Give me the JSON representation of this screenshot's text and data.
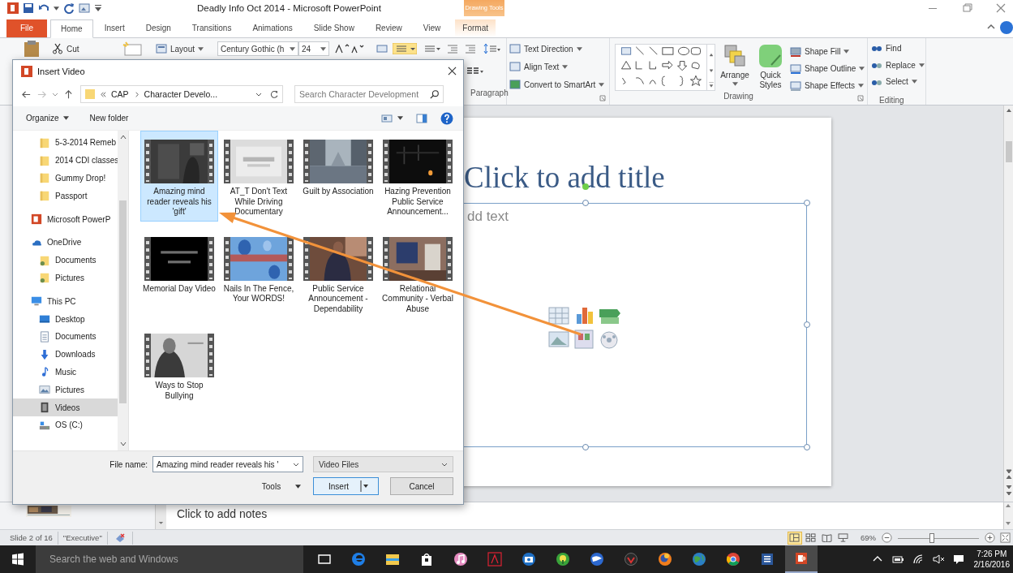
{
  "window": {
    "title": "Deadly Info Oct 2014  -  Microsoft PowerPoint",
    "context_label": "Drawing Tools"
  },
  "tabs": [
    {
      "label": "File",
      "kind": "file",
      "selected": false
    },
    {
      "label": "Home",
      "kind": "main",
      "selected": true
    },
    {
      "label": "Insert",
      "kind": "main",
      "selected": false
    },
    {
      "label": "Design",
      "kind": "main",
      "selected": false
    },
    {
      "label": "Transitions",
      "kind": "main",
      "selected": false
    },
    {
      "label": "Animations",
      "kind": "main",
      "selected": false
    },
    {
      "label": "Slide Show",
      "kind": "main",
      "selected": false
    },
    {
      "label": "Review",
      "kind": "main",
      "selected": false
    },
    {
      "label": "View",
      "kind": "main",
      "selected": false
    },
    {
      "label": "Format",
      "kind": "contextual",
      "selected": false
    }
  ],
  "ribbon": {
    "cut": "Cut",
    "layout": {
      "label": "Layout",
      "dropdown": true
    },
    "font": {
      "name": "Century Gothic (h",
      "size": "24"
    },
    "paragraph_label": "Paragraph",
    "text_commands": [
      {
        "label": "Text Direction",
        "dropdown": true
      },
      {
        "label": "Align Text",
        "dropdown": true
      },
      {
        "label": "Convert to SmartArt",
        "dropdown": true
      }
    ],
    "arrange": "Arrange",
    "quick_styles": "Quick Styles",
    "shape_commands": [
      {
        "label": "Shape Fill",
        "dropdown": true
      },
      {
        "label": "Shape Outline",
        "dropdown": true
      },
      {
        "label": "Shape Effects",
        "dropdown": true
      }
    ],
    "drawing_label": "Drawing",
    "editing_commands": [
      {
        "label": "Find",
        "dropdown": false
      },
      {
        "label": "Replace",
        "dropdown": true
      },
      {
        "label": "Select",
        "dropdown": true
      }
    ],
    "editing_label": "Editing"
  },
  "slide": {
    "title_placeholder": "Click to add title",
    "body_text": "dd text"
  },
  "notes": {
    "placeholder": "Click to add notes"
  },
  "status_bar": {
    "slide": "Slide 2 of 16",
    "theme": "\"Executive\"",
    "views": [
      {
        "kind": "normal",
        "selected": true
      },
      {
        "kind": "sorter",
        "selected": false
      },
      {
        "kind": "reading",
        "selected": false
      },
      {
        "kind": "show",
        "selected": false
      }
    ],
    "zoom": "69%",
    "zoom_slider": {
      "level": 0.42
    }
  },
  "taskbar": {
    "search": {
      "placeholder": "Search the web and Windows"
    },
    "apps": [
      {
        "kind": "taskview",
        "active": false
      },
      {
        "kind": "edge",
        "active": false
      },
      {
        "kind": "explorer",
        "active": false
      },
      {
        "kind": "store",
        "active": false
      },
      {
        "kind": "itunes",
        "active": false
      },
      {
        "kind": "acrobat",
        "active": false
      },
      {
        "kind": "camera",
        "active": false
      },
      {
        "kind": "green",
        "active": false
      },
      {
        "kind": "earth",
        "active": false
      },
      {
        "kind": "vivaldi",
        "active": false
      },
      {
        "kind": "firefox",
        "active": false
      },
      {
        "kind": "globe",
        "active": false
      },
      {
        "kind": "chrome",
        "active": false
      },
      {
        "kind": "word",
        "active": false
      },
      {
        "kind": "powerpoint",
        "active": true
      }
    ],
    "time": "7:26 PM",
    "date": "2/16/2016"
  },
  "dialog": {
    "title": "Insert Video",
    "address": [
      "CAP",
      "Character Develo..."
    ],
    "search": {
      "placeholder": "Search Character Development"
    },
    "toolbar": [
      {
        "label": "Organize",
        "dropdown": true
      },
      {
        "label": "New folder",
        "dropdown": false
      }
    ],
    "nav_pane": {
      "scrolled_children": [
        {
          "label": "5-3-2014 Remeb",
          "kind": "folder",
          "selected": false
        },
        {
          "label": "2014 CDI classes",
          "kind": "folder",
          "selected": false
        },
        {
          "label": "Gummy Drop!",
          "kind": "folder",
          "selected": false
        },
        {
          "label": "Passport",
          "kind": "folder",
          "selected": false
        }
      ],
      "items": [
        {
          "label": "Microsoft PowerP",
          "kind": "powerpoint",
          "selected": false
        },
        {
          "label": "OneDrive",
          "kind": "onedrive",
          "selected": false,
          "children": [
            {
              "label": "Documents",
              "kind": "onedrive-folder",
              "selected": false
            },
            {
              "label": "Pictures",
              "kind": "onedrive-folder",
              "selected": false
            }
          ]
        },
        {
          "label": "This PC",
          "kind": "pc",
          "selected": false,
          "children": [
            {
              "label": "Desktop",
              "kind": "desktop",
              "selected": false
            },
            {
              "label": "Documents",
              "kind": "documents",
              "selected": false
            },
            {
              "label": "Downloads",
              "kind": "downloads",
              "selected": false
            },
            {
              "label": "Music",
              "kind": "music",
              "selected": false
            },
            {
              "label": "Pictures",
              "kind": "pictures",
              "selected": false
            },
            {
              "label": "Videos",
              "kind": "videos",
              "selected": true
            },
            {
              "label": "OS (C:)",
              "kind": "drive",
              "selected": false
            }
          ]
        }
      ]
    },
    "files": [
      {
        "name": "Amazing mind reader reveals his 'gift'",
        "selected": true
      },
      {
        "name": "AT_T Don't Text While Driving Documentary",
        "selected": false
      },
      {
        "name": "Guilt by Association",
        "selected": false
      },
      {
        "name": "Hazing Prevention Public Service Announcement...",
        "selected": false
      },
      {
        "name": "Memorial Day Video",
        "selected": false
      },
      {
        "name": "Nails In The Fence, Your WORDS!",
        "selected": false
      },
      {
        "name": "Public Service Announcement - Dependability",
        "selected": false
      },
      {
        "name": "Relational Community - Verbal Abuse",
        "selected": false
      },
      {
        "name": "Ways to Stop Bullying",
        "selected": false
      }
    ],
    "file_name": {
      "label": "File name:",
      "value": "Amazing mind reader reveals his '"
    },
    "file_type": "Video Files",
    "buttons": [
      {
        "label": "Tools",
        "kind": "menu"
      },
      {
        "label": "Insert",
        "kind": "split"
      },
      {
        "label": "Cancel",
        "kind": "normal"
      }
    ]
  }
}
